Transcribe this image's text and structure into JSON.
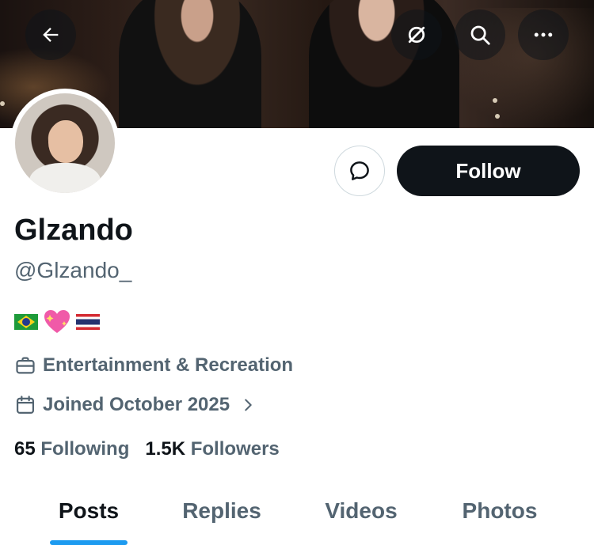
{
  "profile": {
    "display_name": "Glzando",
    "handle": "@Glzando_",
    "bio_emojis": [
      "brazil-flag",
      "sparkling-heart",
      "thailand-flag"
    ],
    "category": "Entertainment & Recreation",
    "joined": "Joined October 2025",
    "following_count": "65",
    "following_label": "Following",
    "followers_count": "1.5K",
    "followers_label": "Followers"
  },
  "actions": {
    "follow_label": "Follow"
  },
  "tabs": [
    {
      "label": "Posts",
      "active": true
    },
    {
      "label": "Replies",
      "active": false
    },
    {
      "label": "Videos",
      "active": false
    },
    {
      "label": "Photos",
      "active": false
    }
  ],
  "icons": {
    "back": "arrow-left-icon",
    "grok": "grok-icon",
    "search": "search-icon",
    "more": "more-icon",
    "message": "message-bubble-icon",
    "category": "briefcase-icon",
    "joined": "calendar-icon",
    "joined_arrow": "chevron-right-icon"
  },
  "colors": {
    "text_primary": "#0f1419",
    "text_secondary": "#536471",
    "accent": "#1d9bf0",
    "follow_button_bg": "#0f1419"
  }
}
